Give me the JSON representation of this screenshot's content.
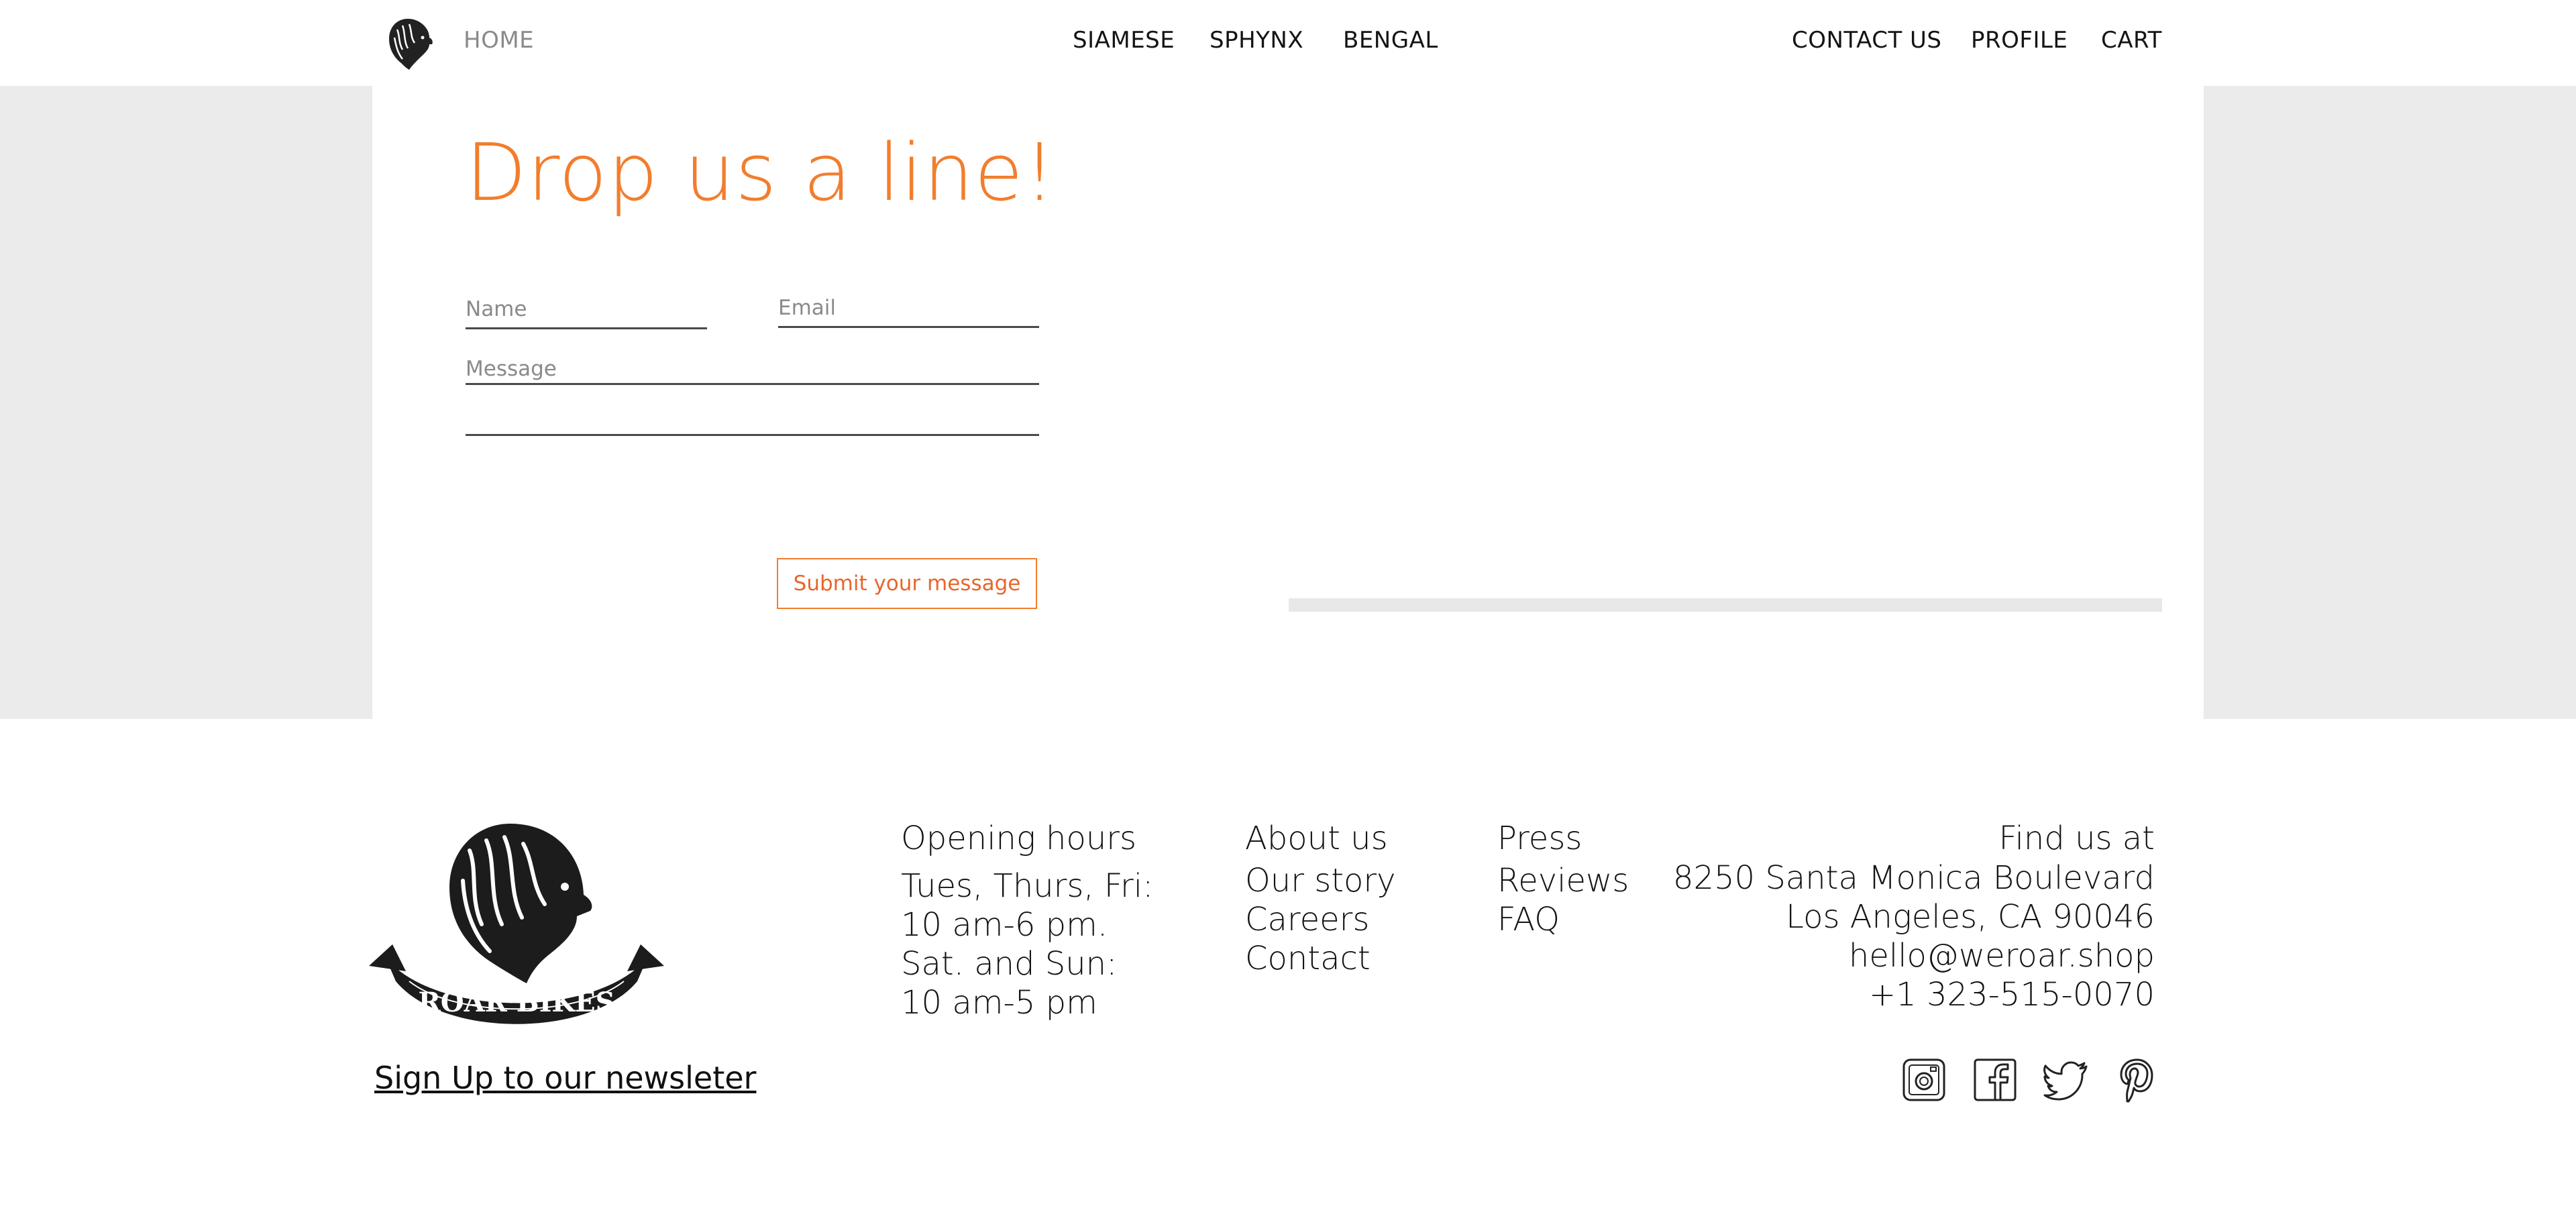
{
  "nav": {
    "home": "HOME",
    "center": [
      "SIAMESE",
      "SPHYNX",
      "BENGAL"
    ],
    "right": [
      "CONTACT US",
      "PROFILE",
      "CART"
    ]
  },
  "contact_form": {
    "heading": "Drop us a line!",
    "name_placeholder": "Name",
    "email_placeholder": "Email",
    "message_placeholder": "Message",
    "submit_label": "Submit your message"
  },
  "footer": {
    "logo_text": "ROAR BIKES",
    "newsletter": "Sign Up to our newsleter",
    "hours": {
      "title": "Opening hours",
      "lines": [
        "Tues, Thurs, Fri:",
        "10 am-6 pm.",
        "Sat. and Sun:",
        "10 am-5 pm"
      ]
    },
    "about": {
      "title": "About us",
      "links": [
        "Our story",
        "Careers",
        "Contact"
      ]
    },
    "press": {
      "title": "Press",
      "links": [
        "Reviews",
        "FAQ"
      ]
    },
    "find": {
      "title": "Find us at",
      "lines": [
        "8250 Santa Monica Boulevard",
        "Los Angeles, CA 90046",
        "hello@weroar.shop",
        "+1 323-515-0070"
      ]
    },
    "social_icons": [
      "instagram-icon",
      "facebook-icon",
      "twitter-icon",
      "pinterest-icon"
    ]
  },
  "colors": {
    "accent": "#f27d2d",
    "band_gray": "#ebebeb",
    "text": "#141414",
    "muted": "#8a8a8a"
  }
}
